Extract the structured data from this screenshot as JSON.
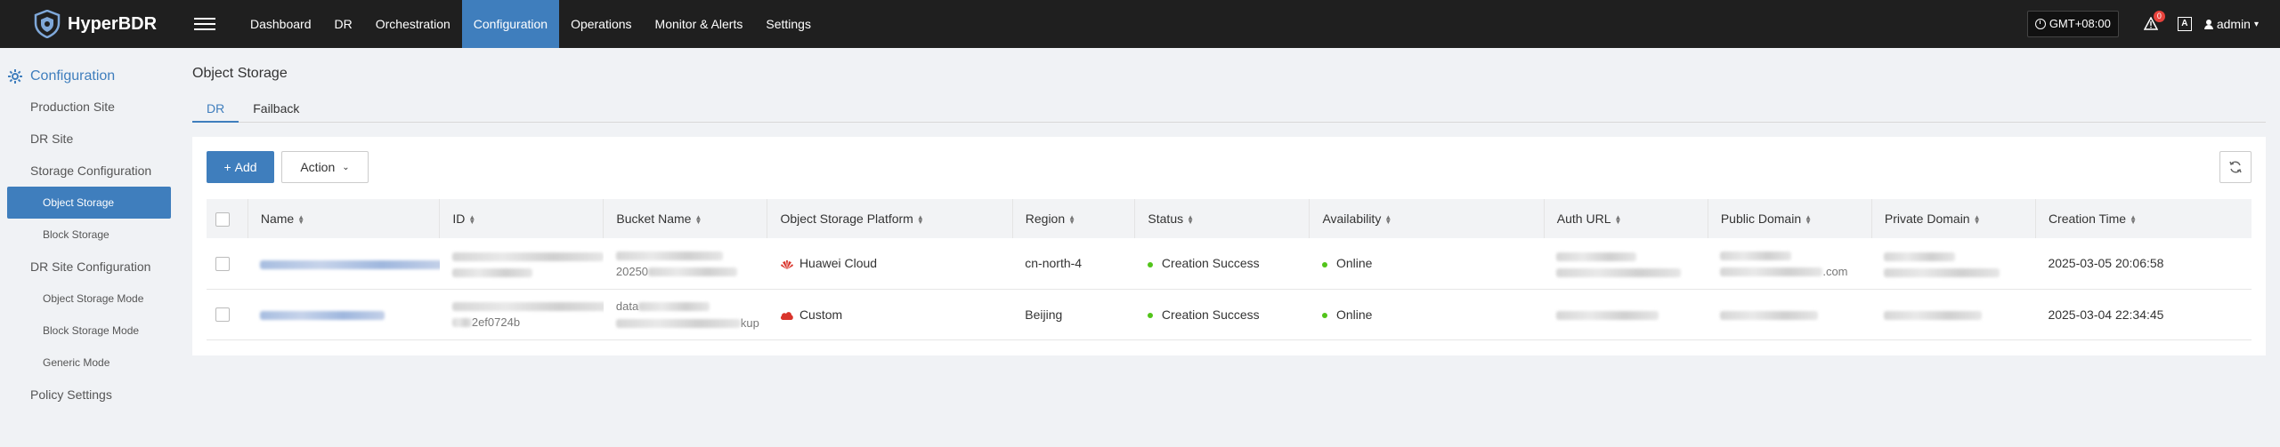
{
  "app": {
    "brand": "HyperBDR"
  },
  "nav": {
    "items": [
      {
        "label": "Dashboard",
        "active": false
      },
      {
        "label": "DR",
        "active": false
      },
      {
        "label": "Orchestration",
        "active": false
      },
      {
        "label": "Configuration",
        "active": true
      },
      {
        "label": "Operations",
        "active": false
      },
      {
        "label": "Monitor & Alerts",
        "active": false
      },
      {
        "label": "Settings",
        "active": false
      }
    ],
    "timezone": "GMT+08:00",
    "alert_count": "0",
    "lang_label": "A",
    "user": "admin"
  },
  "sidebar": {
    "header": "Configuration",
    "items": [
      {
        "label": "Production Site",
        "level": 1
      },
      {
        "label": "DR Site",
        "level": 1
      },
      {
        "label": "Storage Configuration",
        "level": 1
      },
      {
        "label": "Object Storage",
        "level": 2,
        "active": true
      },
      {
        "label": "Block Storage",
        "level": 2
      },
      {
        "label": "DR Site Configuration",
        "level": 1
      },
      {
        "label": "Object Storage Mode",
        "level": 2
      },
      {
        "label": "Block Storage Mode",
        "level": 2
      },
      {
        "label": "Generic Mode",
        "level": 2
      },
      {
        "label": "Policy Settings",
        "level": 1
      }
    ]
  },
  "page": {
    "title": "Object Storage",
    "tabs": [
      {
        "label": "DR",
        "active": true
      },
      {
        "label": "Failback",
        "active": false
      }
    ],
    "add_label": "Add",
    "action_label": "Action"
  },
  "table": {
    "columns": [
      "Name",
      "ID",
      "Bucket Name",
      "Object Storage Platform",
      "Region",
      "Status",
      "Availability",
      "Auth URL",
      "Public Domain",
      "Private Domain",
      "Creation Time"
    ],
    "rows": [
      {
        "id_suffix": "",
        "bucket_line2": "20250",
        "bucket_suffix": "",
        "platform": "Huawei Cloud",
        "platform_icon": "huawei-icon",
        "region": "cn-north-4",
        "status": "Creation Success",
        "availability": "Online",
        "public_suffix": ".com",
        "created": "2025-03-05 20:06:58"
      },
      {
        "id_suffix": "2ef0724b",
        "bucket_line1": "data",
        "bucket_suffix": "kup",
        "platform": "Custom",
        "platform_icon": "cloud-icon",
        "region": "Beijing",
        "status": "Creation Success",
        "availability": "Online",
        "public_suffix": "",
        "created": "2025-03-04 22:34:45"
      }
    ]
  },
  "colors": {
    "accent": "#3f7ebd",
    "topbar": "#1f1f1f",
    "success": "#52c41a",
    "badge": "#e8423c"
  }
}
